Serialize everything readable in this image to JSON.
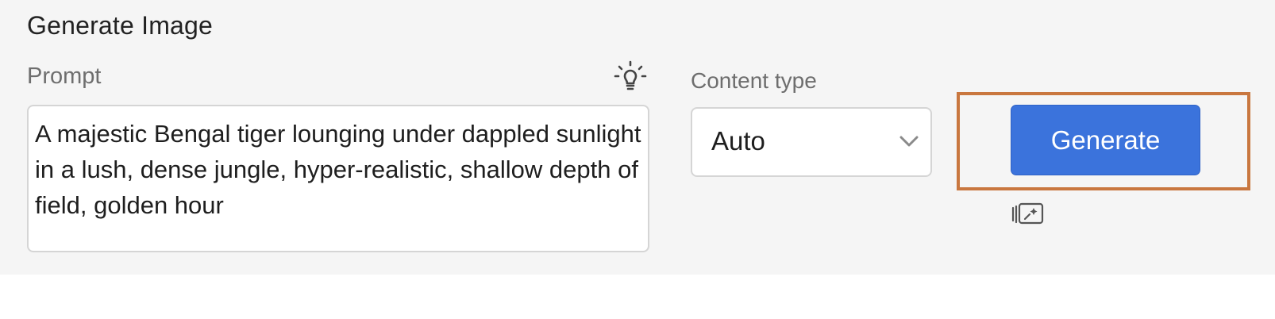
{
  "panel": {
    "title": "Generate Image"
  },
  "prompt": {
    "label": "Prompt",
    "value": "A majestic Bengal tiger lounging under dappled sunlight in a lush, dense jungle, hyper-realistic, shallow depth of field, golden hour",
    "hint_icon": "lightbulb-icon"
  },
  "content_type": {
    "label": "Content type",
    "selected": "Auto",
    "dropdown_icon": "chevron-down-icon"
  },
  "generate": {
    "label": "Generate",
    "color": "#3b73dc",
    "highlight_color": "#c9773f",
    "secondary_icon": "image-stack-sparkle-icon"
  }
}
